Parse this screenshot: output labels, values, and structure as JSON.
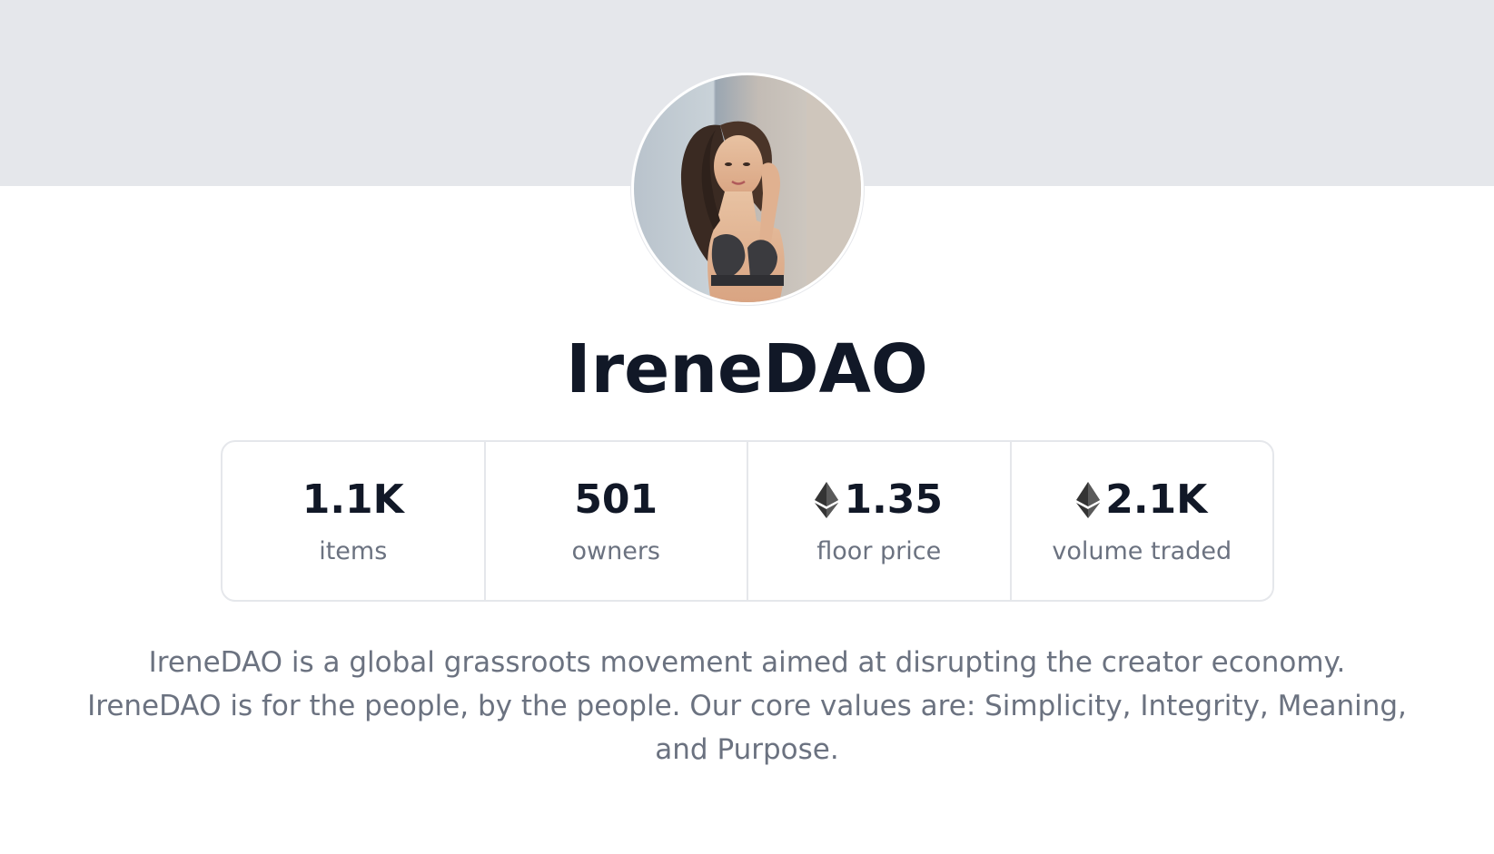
{
  "collection": {
    "name": "IreneDAO",
    "description": "IreneDAO is a global grassroots movement aimed at disrupting the creator economy. IreneDAO is for the people, by the people. Our core values are: Simplicity, Integrity, Meaning, and Purpose."
  },
  "stats": [
    {
      "value": "1.1K",
      "label": "items",
      "icon": ""
    },
    {
      "value": "501",
      "label": "owners",
      "icon": ""
    },
    {
      "value": "1.35",
      "label": "floor price",
      "icon": "ethereum-icon"
    },
    {
      "value": "2.1K",
      "label": "volume traded",
      "icon": "ethereum-icon"
    }
  ],
  "colors": {
    "banner": "#e5e7eb",
    "title": "#111827",
    "muted": "#6b7280",
    "border": "#e5e7eb"
  }
}
